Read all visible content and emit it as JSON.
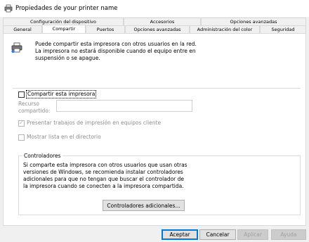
{
  "window": {
    "title": "Propiedades de your printer name",
    "icon": "printer-icon"
  },
  "tabs_row1": [
    {
      "label": "Configuración del dispositivo"
    },
    {
      "label": "Accesorios"
    },
    {
      "label": "Opciones avanzadas"
    }
  ],
  "tabs_row2": [
    {
      "label": "General"
    },
    {
      "label": "Compartir",
      "active": true
    },
    {
      "label": "Puertos"
    },
    {
      "label": "Opciones avanzadas"
    },
    {
      "label": "Administración del color"
    },
    {
      "label": "Seguridad"
    }
  ],
  "sharing": {
    "info_text": "Puede compartir esta impresora con otros usuarios en la red. La impresora no estará disponible cuando el equipo entre en suspensión o se apague.",
    "share_checkbox": {
      "label": "Compartir esta impresora",
      "checked": false
    },
    "share_name": {
      "label": "Recurso compartido:",
      "value": ""
    },
    "render_jobs": {
      "label": "Presentar trabajos de impresión en equipos cliente",
      "checked": true,
      "enabled": false
    },
    "list_directory": {
      "label": "Mostrar lista en el directorio",
      "checked": false,
      "enabled": false
    }
  },
  "drivers": {
    "group_title": "Controladores",
    "text": "Si comparte esta impresora con otros usuarios que usan otras versiones de Windows, se recomienda instalar controladores adicionales para que no tengan que buscar el controlador de la impresora cuando se conecten a la impresora compartida.",
    "button_label": "Controladores adicionales..."
  },
  "footer": {
    "ok": "Aceptar",
    "cancel": "Cancelar",
    "apply": "Aplicar",
    "help": "Ayuda"
  },
  "colors": {
    "focus_border": "#0078d7",
    "panel": "#ffffff",
    "dialog": "#f0f0f0"
  }
}
